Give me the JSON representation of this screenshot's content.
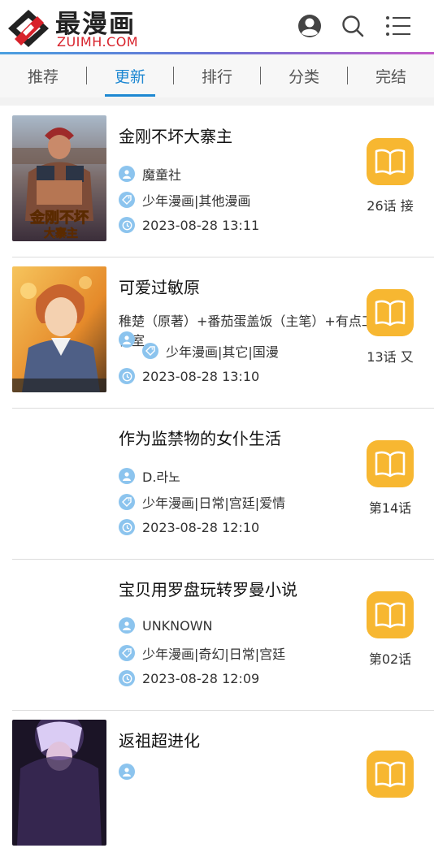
{
  "header": {
    "logo_cn": "最漫画",
    "logo_en": "ZUIMH.COM",
    "icons": [
      "user-icon",
      "search-icon",
      "menu-icon"
    ]
  },
  "tabs": [
    {
      "label": "推荐",
      "active": false
    },
    {
      "label": "更新",
      "active": true
    },
    {
      "label": "排行",
      "active": false
    },
    {
      "label": "分类",
      "active": false
    },
    {
      "label": "完结",
      "active": false
    }
  ],
  "colors": {
    "accent": "#1e88d2",
    "brand_red": "#d8222b",
    "book_badge": "#f7b731",
    "meta_icon": "#8cc4ee"
  },
  "items": [
    {
      "title": "金刚不坏大寨主",
      "author": "魔童社",
      "tags": "少年漫画|其他漫画",
      "date": "2023-08-28 13:11",
      "chapter": "26话 接",
      "cover": "cover-1"
    },
    {
      "title": "可爱过敏原",
      "author": "稚楚（原著）+番茄蛋盖饭（主笔）+有点工作室",
      "tags": "少年漫画|其它|国漫",
      "date": "2023-08-28 13:10",
      "chapter": "13话 又",
      "cover": "cover-2"
    },
    {
      "title": "作为监禁物的女仆生活",
      "author": "D.라노",
      "tags": "少年漫画|日常|宫廷|爱情",
      "date": "2023-08-28 12:10",
      "chapter": "第14话",
      "cover": ""
    },
    {
      "title": "宝贝用罗盘玩转罗曼小说",
      "author": "UNKNOWN",
      "tags": "少年漫画|奇幻|日常|宫廷",
      "date": "2023-08-28 12:09",
      "chapter": "第02话",
      "cover": ""
    },
    {
      "title": "返祖超进化",
      "author": "",
      "tags": "",
      "date": "",
      "chapter": "",
      "cover": "cover-5"
    }
  ]
}
